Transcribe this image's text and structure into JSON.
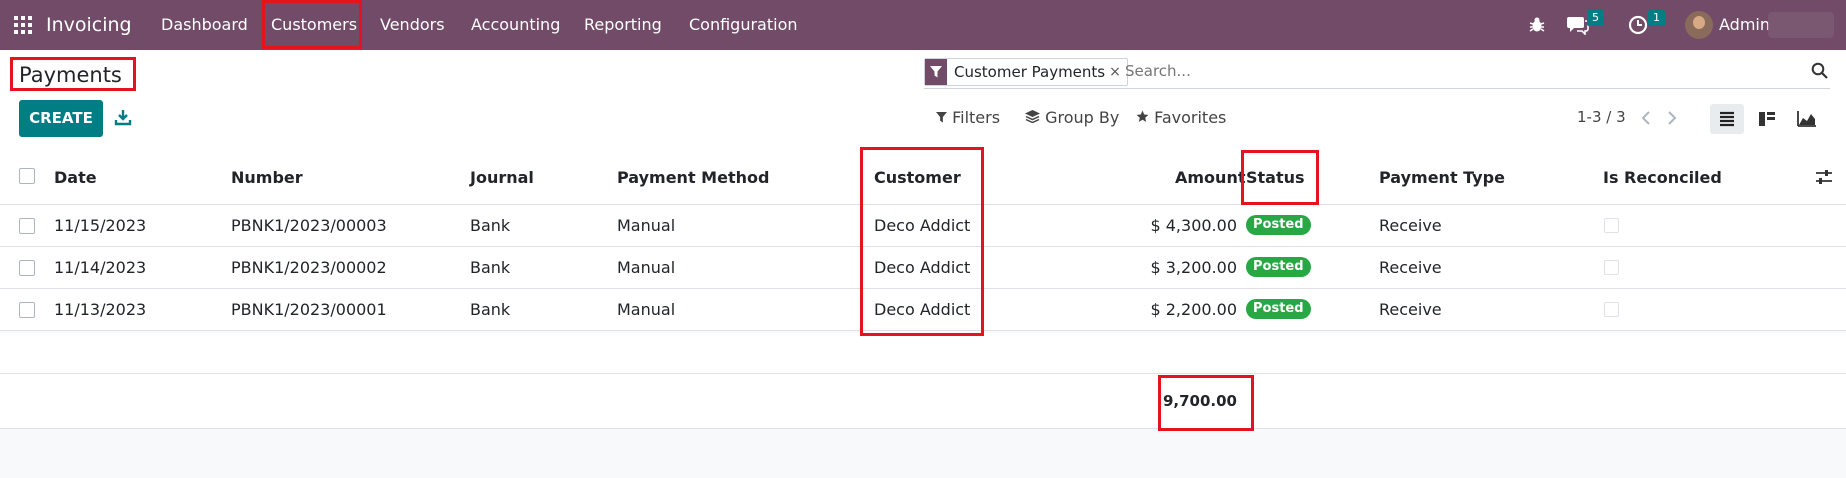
{
  "navbar": {
    "app_name": "Invoicing",
    "menu": [
      "Dashboard",
      "Customers",
      "Vendors",
      "Accounting",
      "Reporting",
      "Configuration"
    ],
    "messages_count": "5",
    "activities_count": "1",
    "user_name": "Admin"
  },
  "control_panel": {
    "title": "Payments",
    "create_label": "CREATE",
    "search": {
      "facet_label": "Customer Payments",
      "facet_remove": "×",
      "placeholder": "Search..."
    },
    "filters_label": "Filters",
    "groupby_label": "Group By",
    "favorites_label": "Favorites",
    "pager": "1-3 / 3"
  },
  "table": {
    "columns": [
      "Date",
      "Number",
      "Journal",
      "Payment Method",
      "Customer",
      "Amount",
      "Status",
      "Payment Type",
      "Is Reconciled"
    ],
    "rows": [
      {
        "date": "11/15/2023",
        "number": "PBNK1/2023/00003",
        "journal": "Bank",
        "method": "Manual",
        "customer": "Deco Addict",
        "amount": "$ 4,300.00",
        "status": "Posted",
        "type": "Receive",
        "reconciled": false
      },
      {
        "date": "11/14/2023",
        "number": "PBNK1/2023/00002",
        "journal": "Bank",
        "method": "Manual",
        "customer": "Deco Addict",
        "amount": "$ 3,200.00",
        "status": "Posted",
        "type": "Receive",
        "reconciled": false
      },
      {
        "date": "11/13/2023",
        "number": "PBNK1/2023/00001",
        "journal": "Bank",
        "method": "Manual",
        "customer": "Deco Addict",
        "amount": "$ 2,200.00",
        "status": "Posted",
        "type": "Receive",
        "reconciled": false
      }
    ],
    "total_amount": "9,700.00"
  },
  "colors": {
    "navbar": "#714b67",
    "primary": "#017e84",
    "posted_badge": "#28a745",
    "highlight": "#e5121f"
  }
}
